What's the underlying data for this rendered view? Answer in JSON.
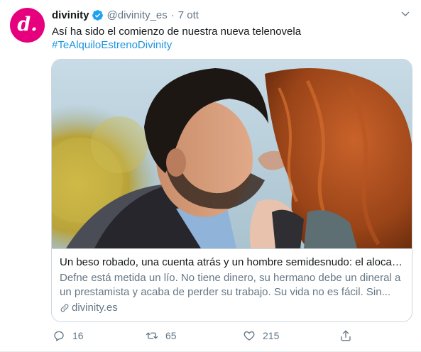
{
  "tweet": {
    "avatar_letter": "d.",
    "display_name": "divinity",
    "handle": "@divinity_es",
    "separator": "·",
    "timestamp": "7 ott",
    "text_line1": "Así ha sido el comienzo de nuestra nueva telenovela",
    "hashtag": "#TeAlquiloEstrenoDivinity",
    "brand_color": "#e6007e",
    "link_color": "#1b95e0",
    "verified_color": "#1da1f2"
  },
  "card": {
    "title": "Un beso robado, una cuenta atrás y un hombre semidesnudo: el alocad...",
    "description_line1": "Defne está metida un lío. No tiene dinero, su hermano debe un dineral a",
    "description_line2": "un prestamista y acaba de perder su trabajo. Su vida no es fácil. Sin...",
    "domain": "divinity.es",
    "image_icon": "kiss-scene-photo"
  },
  "actions": {
    "reply_count": "16",
    "retweet_count": "65",
    "like_count": "215",
    "reply_icon": "reply-icon",
    "retweet_icon": "retweet-icon",
    "like_icon": "heart-icon",
    "share_icon": "share-icon"
  }
}
